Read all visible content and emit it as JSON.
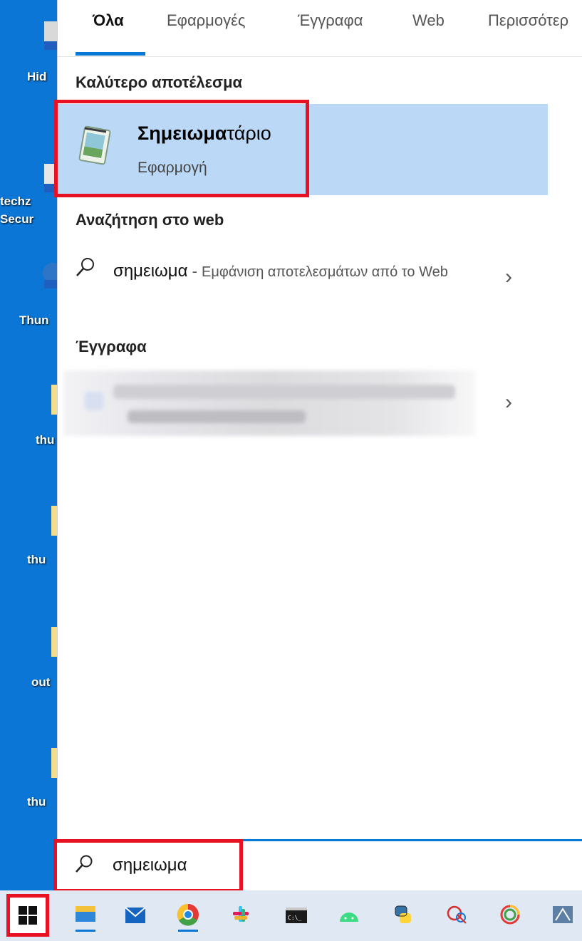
{
  "desktop": {
    "labels": [
      "Hid",
      "techz",
      "Secur",
      "Thun",
      "thu",
      "thu",
      "out",
      "thu"
    ]
  },
  "tabs": [
    {
      "label": "Όλα",
      "active": true
    },
    {
      "label": "Εφαρμογές",
      "active": false
    },
    {
      "label": "Έγγραφα",
      "active": false
    },
    {
      "label": "Web",
      "active": false
    },
    {
      "label": "Περισσότερ",
      "active": false
    }
  ],
  "best_match": {
    "header": "Καλύτερο αποτέλεσμα",
    "name_bold": "Σημειωμα",
    "name_rest": "τάριο",
    "type": "Εφαρμογή"
  },
  "web_search": {
    "header": "Αναζήτηση στο web",
    "query": "σημειωμα",
    "separator": " - ",
    "suffix": "Εμφάνιση αποτελεσμάτων από το Web",
    "chevron": "›"
  },
  "documents": {
    "header": "Έγγραφα",
    "chevron": "›"
  },
  "search": {
    "value": "σημειωμα"
  },
  "taskbar": {
    "apps": [
      "file-explorer",
      "mail",
      "chrome",
      "slack",
      "command-prompt",
      "android-studio",
      "python",
      "snipping-tool",
      "app-swirl",
      "app-blue"
    ]
  },
  "colors": {
    "accent": "#0a78d7",
    "highlight_border": "#e81123",
    "best_match_bg": "#bbd9f6"
  }
}
